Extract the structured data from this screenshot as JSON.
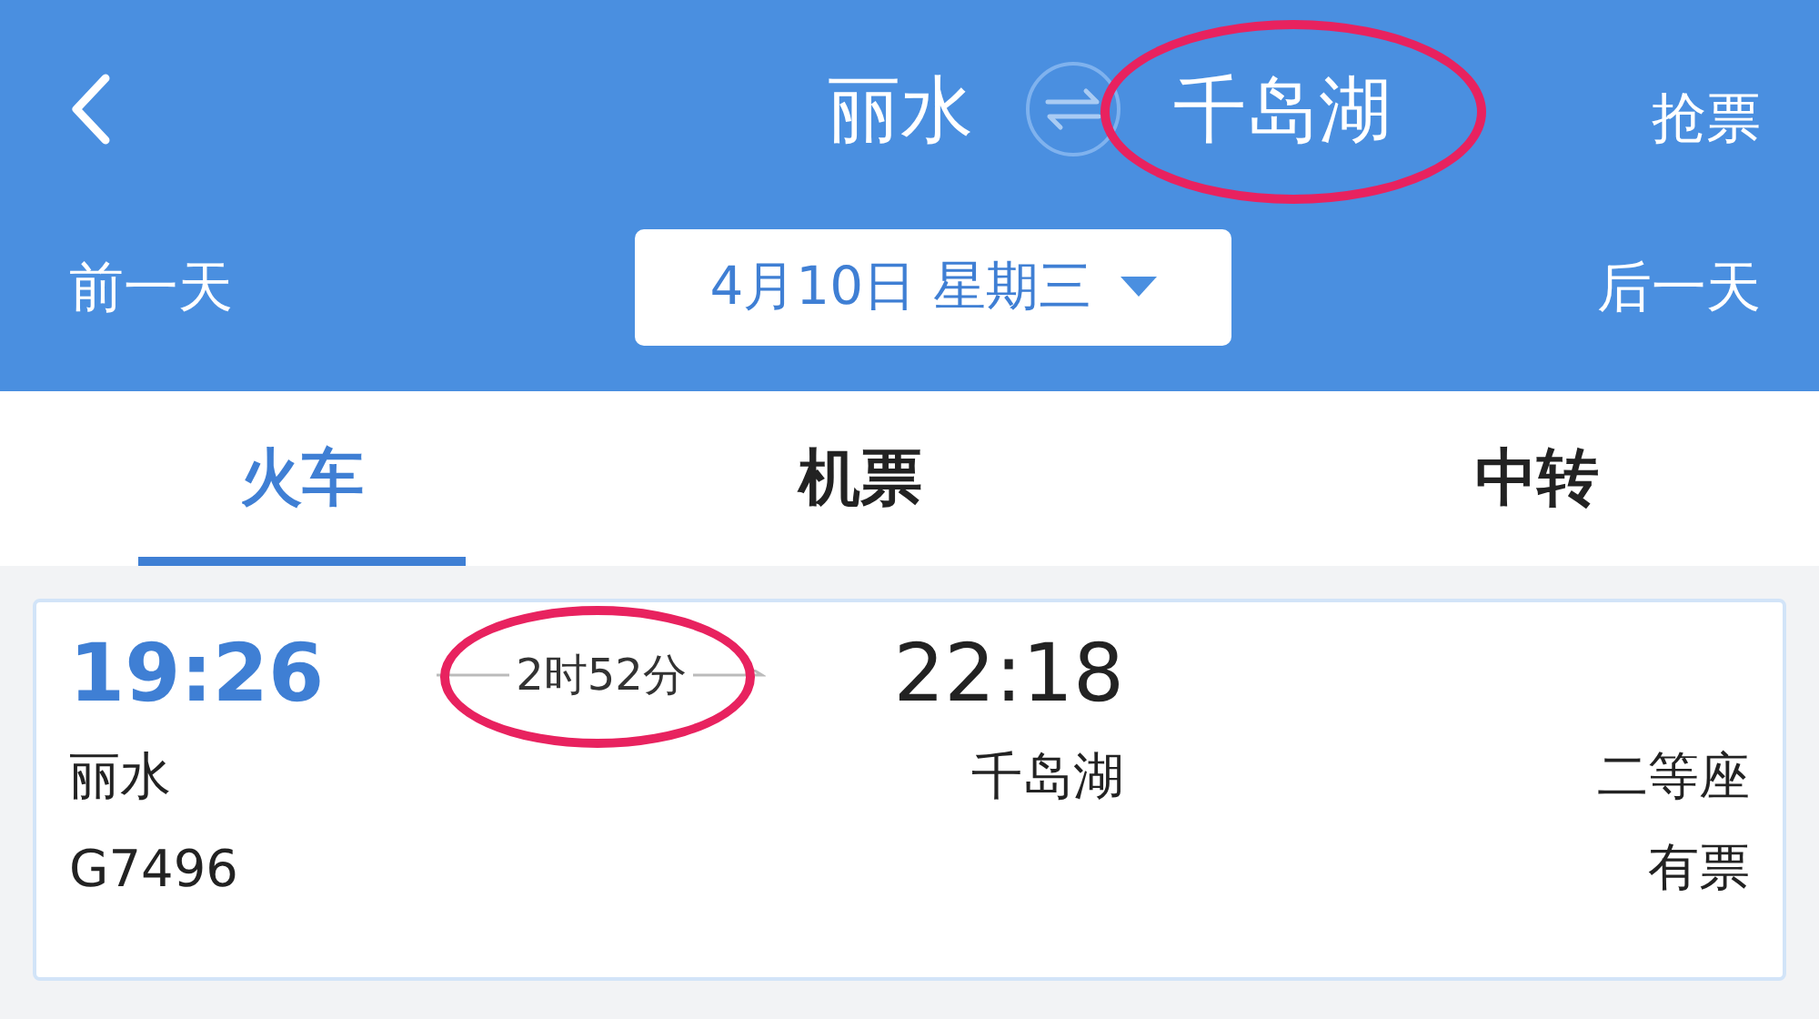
{
  "header": {
    "from": "丽水",
    "to": "千岛湖",
    "to_circled": true,
    "action": "抢票",
    "prev_day": "前一天",
    "date": "4月10日 星期三",
    "next_day": "后一天"
  },
  "tabs": [
    {
      "label": "火车",
      "selected": true
    },
    {
      "label": "机票",
      "selected": false
    },
    {
      "label": "中转",
      "selected": false
    }
  ],
  "trains": [
    {
      "depart_time": "19:26",
      "duration": "2时52分",
      "duration_circled": true,
      "arrive_time": "22:18",
      "from": "丽水",
      "to": "千岛湖",
      "seat_class": "二等座",
      "train_no": "G7496",
      "availability": "有票"
    }
  ]
}
